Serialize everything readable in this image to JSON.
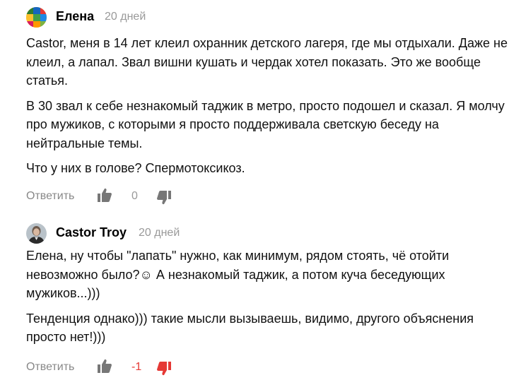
{
  "colors": {
    "text": "#111111",
    "muted": "#999999",
    "action_icon": "#777777",
    "negative": "#e53935"
  },
  "comments": [
    {
      "author": "Елена",
      "time": "20 дней",
      "avatar_icon": "colorful-mosaic-avatar",
      "paragraphs": [
        "Castor, меня в 14 лет клеил охранник детского лагеря, где мы отдыхали. Даже не клеил, а лапал. Звал вишни кушать и чердак хотел показать. Это же вообще статья.",
        "В 30 звал к себе незнакомый таджик в метро, просто подошел и сказал. Я молчу про мужиков, с которыми я просто поддерживала светскую беседу на нейтральные темы.",
        "Что у них в голове? Спермотоксикоз."
      ],
      "reply_label": "Ответить",
      "score": "0",
      "dislike_active": false
    },
    {
      "author": "Castor Troy",
      "time": "20 дней",
      "avatar_icon": "person-photo-avatar",
      "paragraphs": [
        "Елена, ну чтобы \"лапать\" нужно, как минимум, рядом стоять, чё отойти невозможно было?☺ А незнакомый таджик, а потом куча беседующих мужиков...)))",
        "Тенденция однако))) такие мысли вызываешь, видимо, другого объяснения просто нет!)))"
      ],
      "reply_label": "Ответить",
      "score": "-1",
      "dislike_active": true
    }
  ]
}
